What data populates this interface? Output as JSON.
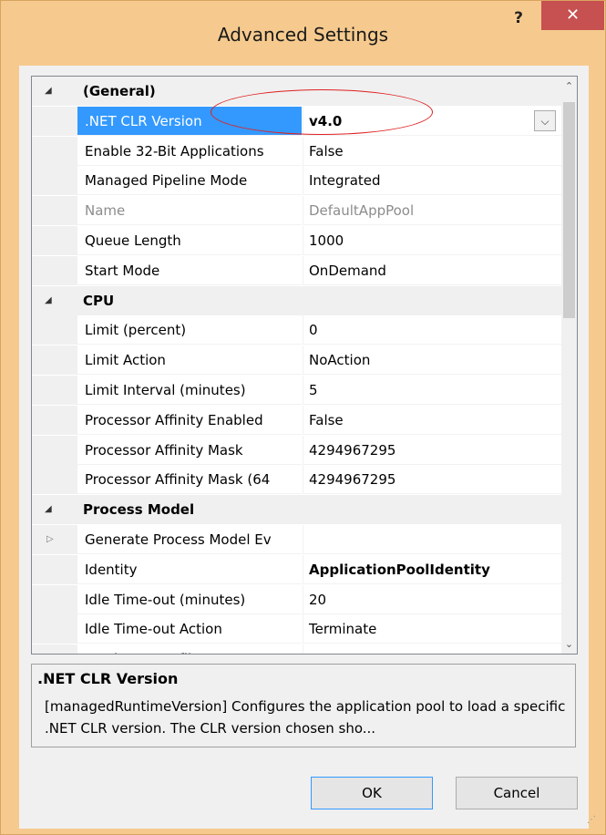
{
  "window": {
    "title": "Advanced Settings",
    "help": "?",
    "close": "✕"
  },
  "grid": {
    "rows": [
      {
        "type": "category",
        "label": "(General)",
        "toggle": "◢"
      },
      {
        "type": "prop",
        "name": ".NET CLR Version",
        "value": "v4.0",
        "selected": true,
        "bold": true,
        "dropdown": "⌵"
      },
      {
        "type": "prop",
        "name": "Enable 32-Bit Applications",
        "value": "False"
      },
      {
        "type": "prop",
        "name": "Managed Pipeline Mode",
        "value": "Integrated"
      },
      {
        "type": "prop",
        "name": "Name",
        "value": "DefaultAppPool",
        "disabled": true
      },
      {
        "type": "prop",
        "name": "Queue Length",
        "value": "1000"
      },
      {
        "type": "prop",
        "name": "Start Mode",
        "value": "OnDemand"
      },
      {
        "type": "category",
        "label": "CPU",
        "toggle": "◢"
      },
      {
        "type": "prop",
        "name": "Limit (percent)",
        "value": "0"
      },
      {
        "type": "prop",
        "name": "Limit Action",
        "value": "NoAction"
      },
      {
        "type": "prop",
        "name": "Limit Interval (minutes)",
        "value": "5"
      },
      {
        "type": "prop",
        "name": "Processor Affinity Enabled",
        "value": "False"
      },
      {
        "type": "prop",
        "name": "Processor Affinity Mask",
        "value": "4294967295"
      },
      {
        "type": "prop",
        "name": "Processor Affinity Mask (64",
        "value": "4294967295"
      },
      {
        "type": "category",
        "label": "Process Model",
        "toggle": "◢"
      },
      {
        "type": "prop",
        "name": "Generate Process Model Ev",
        "value": "",
        "expander": "▷"
      },
      {
        "type": "prop",
        "name": "Identity",
        "value": "ApplicationPoolIdentity",
        "bold": true
      },
      {
        "type": "prop",
        "name": "Idle Time-out (minutes)",
        "value": "20"
      },
      {
        "type": "prop",
        "name": "Idle Time-out Action",
        "value": "Terminate"
      },
      {
        "type": "prop",
        "name": "Load User Profile",
        "value": "True"
      }
    ],
    "scroll_up": "⌃",
    "scroll_down": "⌄"
  },
  "description": {
    "title": ".NET CLR Version",
    "text": "[managedRuntimeVersion] Configures the application pool to load a specific .NET CLR version.  The CLR version chosen sho..."
  },
  "buttons": {
    "ok": "OK",
    "cancel": "Cancel"
  }
}
